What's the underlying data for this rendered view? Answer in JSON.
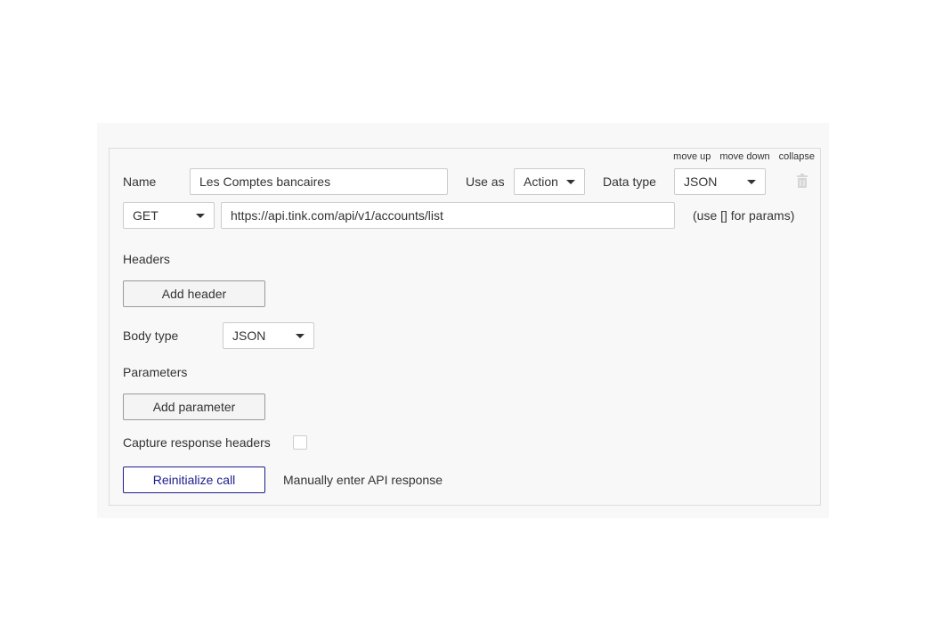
{
  "top_links": {
    "move_up": "move up",
    "move_down": "move down",
    "collapse": "collapse"
  },
  "name": {
    "label": "Name",
    "value": "Les Comptes bancaires"
  },
  "use_as": {
    "label": "Use as",
    "value": "Action"
  },
  "data_type": {
    "label": "Data type",
    "value": "JSON"
  },
  "method": {
    "value": "GET"
  },
  "url": {
    "value": "https://api.tink.com/api/v1/accounts/list",
    "hint": "(use [] for params)"
  },
  "headers": {
    "label": "Headers",
    "add_label": "Add header"
  },
  "body_type": {
    "label": "Body type",
    "value": "JSON"
  },
  "parameters": {
    "label": "Parameters",
    "add_label": "Add parameter"
  },
  "capture": {
    "label": "Capture response headers",
    "checked": false
  },
  "actions": {
    "reinitialize_label": "Reinitialize call",
    "manual_label": "Manually enter API response"
  },
  "icons": {
    "delete": "trash-icon"
  },
  "colors": {
    "primary": "#1e1e8c",
    "panel_bg": "#f8f8f8",
    "border": "#dddddd"
  }
}
